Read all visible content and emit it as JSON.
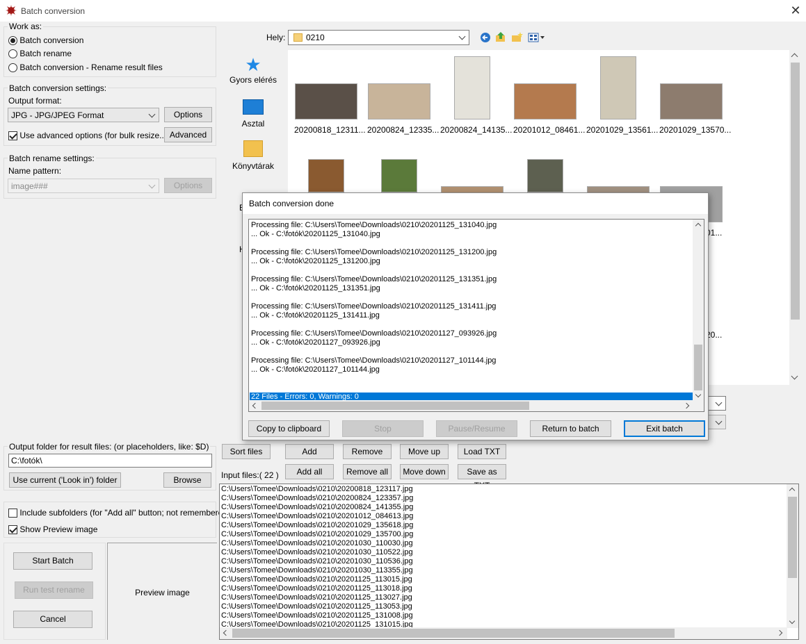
{
  "window": {
    "title": "Batch conversion",
    "close_glyph": "✕"
  },
  "work_as": {
    "label": "Work as:",
    "options": [
      "Batch conversion",
      "Batch rename",
      "Batch conversion - Rename result files"
    ],
    "selected_index": 0
  },
  "conversion_settings": {
    "label": "Batch conversion settings:",
    "output_format_label": "Output format:",
    "output_format_value": "JPG - JPG/JPEG Format",
    "options_button": "Options",
    "advanced_checkbox_label": "Use advanced options (for bulk resize...)",
    "advanced_checked": true,
    "advanced_button": "Advanced"
  },
  "rename_settings": {
    "label": "Batch rename settings:",
    "name_pattern_label": "Name pattern:",
    "name_pattern_value": "image###",
    "options_button": "Options"
  },
  "output_folder": {
    "label": "Output folder for result files: (or placeholders, like: $D)",
    "value": "C:\\fotók\\",
    "use_current_button": "Use current ('Look in') folder",
    "browse_button": "Browse"
  },
  "checkboxes": {
    "include_subfolders": "Include subfolders (for \"Add all\" button; not remembered)",
    "include_subfolders_checked": false,
    "show_preview": "Show Preview image",
    "show_preview_checked": true
  },
  "actions": {
    "start_batch": "Start Batch",
    "run_test_rename": "Run test rename",
    "cancel": "Cancel",
    "preview_image": "Preview image"
  },
  "browser": {
    "location_label": "Hely:",
    "location_value": "0210",
    "places": [
      "Gyors elérés",
      "Asztal",
      "Könyvtárak"
    ],
    "places_partial": [
      "E",
      "H"
    ],
    "thumbnails": [
      {
        "caption": "20200818_12311...",
        "color": "#5a5048"
      },
      {
        "caption": "20200824_12335...",
        "color": "#c8b49a"
      },
      {
        "caption": "20200824_14135...",
        "color": "#e4e2da"
      },
      {
        "caption": "20201012_08461...",
        "color": "#b47a4e"
      },
      {
        "caption": "20201029_13561...",
        "color": "#cfc8b6"
      },
      {
        "caption": "20201029_13570...",
        "color": "#8d7c6e"
      }
    ],
    "thumbnail_row2_colors": [
      "#8a5a30",
      "#5b7a3a",
      "#b09070",
      "#5d6050",
      "#a09080",
      "#a0a0a0"
    ],
    "partial_caption_right1": "01...",
    "partial_caption_right2": "20..."
  },
  "dialog": {
    "title": "Batch conversion done",
    "log": [
      {
        "src": "Processing file: C:\\Users\\Tomee\\Downloads\\0210\\20201125_131040.jpg",
        "ok": "... Ok - C:\\fotók\\20201125_131040.jpg"
      },
      {
        "src": "Processing file: C:\\Users\\Tomee\\Downloads\\0210\\20201125_131200.jpg",
        "ok": "... Ok - C:\\fotók\\20201125_131200.jpg"
      },
      {
        "src": "Processing file: C:\\Users\\Tomee\\Downloads\\0210\\20201125_131351.jpg",
        "ok": "... Ok - C:\\fotók\\20201125_131351.jpg"
      },
      {
        "src": "Processing file: C:\\Users\\Tomee\\Downloads\\0210\\20201125_131411.jpg",
        "ok": "... Ok - C:\\fotók\\20201125_131411.jpg"
      },
      {
        "src": "Processing file: C:\\Users\\Tomee\\Downloads\\0210\\20201127_093926.jpg",
        "ok": "... Ok - C:\\fotók\\20201127_093926.jpg"
      },
      {
        "src": "Processing file: C:\\Users\\Tomee\\Downloads\\0210\\20201127_101144.jpg",
        "ok": "... Ok - C:\\fotók\\20201127_101144.jpg"
      }
    ],
    "summary": "22 Files - Errors: 0, Warnings: 0",
    "buttons": {
      "copy": "Copy to clipboard",
      "stop": "Stop",
      "pause": "Pause/Resume",
      "return": "Return to batch",
      "exit": "Exit batch"
    }
  },
  "file_buttons": {
    "sort": "Sort files",
    "add": "Add",
    "remove": "Remove",
    "move_up": "Move up",
    "load_txt": "Load TXT",
    "add_all": "Add all",
    "remove_all": "Remove all",
    "move_down": "Move down",
    "save_txt": "Save as TXT"
  },
  "input_files": {
    "label": "Input files:( 22 )",
    "files": [
      "C:\\Users\\Tomee\\Downloads\\0210\\20200818_123117.jpg",
      "C:\\Users\\Tomee\\Downloads\\0210\\20200824_123357.jpg",
      "C:\\Users\\Tomee\\Downloads\\0210\\20200824_141355.jpg",
      "C:\\Users\\Tomee\\Downloads\\0210\\20201012_084613.jpg",
      "C:\\Users\\Tomee\\Downloads\\0210\\20201029_135618.jpg",
      "C:\\Users\\Tomee\\Downloads\\0210\\20201029_135700.jpg",
      "C:\\Users\\Tomee\\Downloads\\0210\\20201030_110030.jpg",
      "C:\\Users\\Tomee\\Downloads\\0210\\20201030_110522.jpg",
      "C:\\Users\\Tomee\\Downloads\\0210\\20201030_110536.jpg",
      "C:\\Users\\Tomee\\Downloads\\0210\\20201030_113355.jpg",
      "C:\\Users\\Tomee\\Downloads\\0210\\20201125_113015.jpg",
      "C:\\Users\\Tomee\\Downloads\\0210\\20201125_113018.jpg",
      "C:\\Users\\Tomee\\Downloads\\0210\\20201125_113027.jpg",
      "C:\\Users\\Tomee\\Downloads\\0210\\20201125_113053.jpg",
      "C:\\Users\\Tomee\\Downloads\\0210\\20201125_131008.jpg",
      "C:\\Users\\Tomee\\Downloads\\0210\\20201125_131015.jpg"
    ]
  }
}
